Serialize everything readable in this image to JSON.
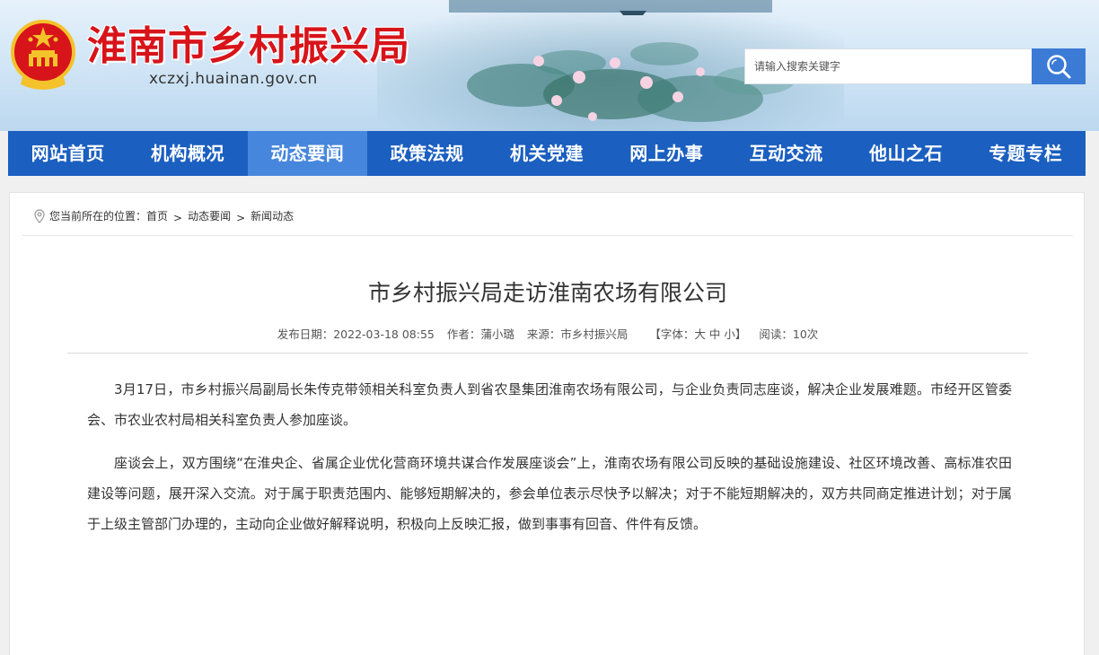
{
  "header": {
    "site_title": "淮南市乡村振兴局",
    "site_domain": "xczxj.huainan.gov.cn",
    "emblem_icon": "national-emblem-icon",
    "title_color": "#d7141a"
  },
  "search": {
    "placeholder": "请输入搜索关键字",
    "button_icon": "search-icon",
    "button_color": "#3b7bd6"
  },
  "nav": {
    "bar_color": "#1b5fc0",
    "active_color": "#4686dd",
    "items": [
      {
        "label": "网站首页"
      },
      {
        "label": "机构概况"
      },
      {
        "label": "动态要闻",
        "active": true
      },
      {
        "label": "政策法规"
      },
      {
        "label": "机关党建"
      },
      {
        "label": "网上办事"
      },
      {
        "label": "互动交流"
      },
      {
        "label": "他山之石"
      },
      {
        "label": "专题专栏"
      }
    ]
  },
  "breadcrumb": {
    "icon": "location-pin-icon",
    "prefix": "您当前所在的位置：",
    "items": [
      "首页",
      "动态要闻",
      "新闻动态"
    ],
    "separator": ">"
  },
  "article": {
    "title": "市乡村振兴局走访淮南农场有限公司",
    "meta": {
      "date": "发布日期：2022-03-18 08:55",
      "author": "作者：蒲小璐",
      "source": "来源：市乡村振兴局",
      "font_label": "【字体：",
      "font_large": "大",
      "font_medium": "中",
      "font_small": "小",
      "font_end": "】",
      "reads": "阅读：10次"
    },
    "paragraphs": [
      "3月17日，市乡村振兴局副局长朱传克带领相关科室负责人到省农垦集团淮南农场有限公司，与企业负责同志座谈，解决企业发展难题。市经开区管委会、市农业农村局相关科室负责人参加座谈。",
      "座谈会上，双方围绕“在淮央企、省属企业优化营商环境共谋合作发展座谈会”上，淮南农场有限公司反映的基础设施建设、社区环境改善、高标准农田建设等问题，展开深入交流。对于属于职责范围内、能够短期解决的，参会单位表示尽快予以解决；对于不能短期解决的，双方共同商定推进计划；对于属于上级主管部门办理的，主动向企业做好解释说明，积极向上反映汇报，做到事事有回音、件件有反馈。"
    ]
  }
}
